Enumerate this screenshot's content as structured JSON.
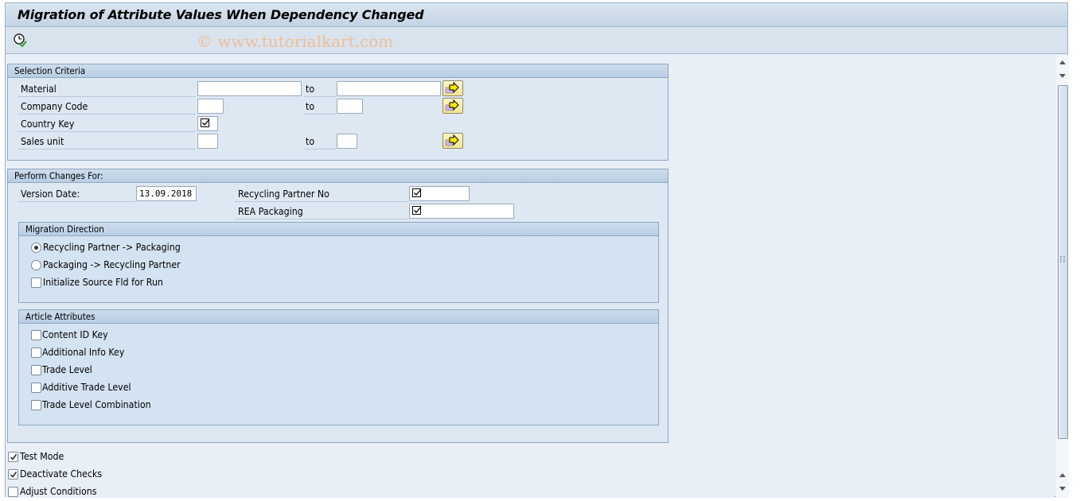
{
  "window": {
    "title": "Migration of Attribute Values When Dependency Changed",
    "watermark": "© www.tutorialkart.com"
  },
  "toolbar": {
    "execute_icon": "execute-clock-check-icon"
  },
  "selection_criteria": {
    "title": "Selection Criteria",
    "to_label": "to",
    "rows": [
      {
        "label": "Material",
        "from": "",
        "to": "",
        "multi_icon": "multiple-selection-arrow-icon"
      },
      {
        "label": "Company Code",
        "from": "",
        "to": "",
        "multi_icon": "multiple-selection-arrow-icon"
      },
      {
        "label": "Country Key",
        "checked": true
      },
      {
        "label": "Sales unit",
        "from": "",
        "to": "",
        "multi_icon": "multiple-selection-arrow-icon"
      }
    ]
  },
  "perform_changes": {
    "title": "Perform Changes For:",
    "version_date_label": "Version Date:",
    "version_date_value": "13.09.2018",
    "recycling_partner_label": "Recycling Partner No",
    "recycling_partner_checked": true,
    "rea_packaging_label": "REA Packaging",
    "rea_packaging_checked": true,
    "migration_direction": {
      "title": "Migration Direction",
      "options": [
        {
          "label": "Recycling Partner -> Packaging",
          "selected": true
        },
        {
          "label": "Packaging -> Recycling Partner",
          "selected": false
        }
      ],
      "initialize_label": "Initialize Source Fld for Run",
      "initialize_checked": false
    },
    "article_attributes": {
      "title": "Article Attributes",
      "items": [
        {
          "label": "Content ID Key",
          "checked": false
        },
        {
          "label": "Additional Info Key",
          "checked": false
        },
        {
          "label": "Trade Level",
          "checked": false
        },
        {
          "label": "Additive Trade Level",
          "checked": false
        },
        {
          "label": "Trade Level Combination",
          "checked": false
        }
      ]
    }
  },
  "options": [
    {
      "label": "Test Mode",
      "checked": true
    },
    {
      "label": "Deactivate Checks",
      "checked": true
    },
    {
      "label": "Adjust Conditions",
      "checked": false
    }
  ],
  "colors": {
    "background": "#e8eff7",
    "group_header": "#c3d5e8",
    "multi_button": "#f3e58e",
    "watermark": "#f2b887"
  }
}
